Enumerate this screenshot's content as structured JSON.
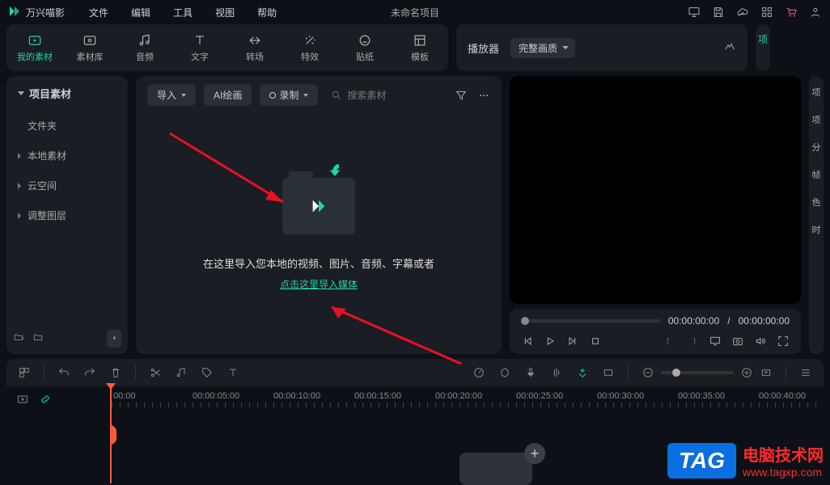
{
  "app": {
    "name": "万兴喵影",
    "project": "未命名项目"
  },
  "menu": {
    "file": "文件",
    "edit": "编辑",
    "tools": "工具",
    "view": "视图",
    "help": "帮助"
  },
  "tabs": {
    "my_media": "我的素材",
    "media_lib": "素材库",
    "audio": "音频",
    "text": "文字",
    "transition": "转场",
    "effects": "特效",
    "stickers": "贴纸",
    "templates": "模板"
  },
  "player": {
    "label": "播放器",
    "quality": "完整画质",
    "time_current": "00:00:00:00",
    "time_total": "00:00:00:00",
    "separator": "/"
  },
  "left": {
    "header": "项目素材",
    "items": {
      "folder": "文件夹",
      "local": "本地素材",
      "cloud": "云空间",
      "adjust": "调整图层"
    }
  },
  "center": {
    "import": "导入",
    "ai_draw": "AI绘画",
    "record": "录制",
    "search_placeholder": "搜索素材",
    "drop_text": "在这里导入您本地的视频、图片、音频、字幕或者",
    "drop_link": "点击这里导入媒体"
  },
  "right_labels": {
    "a": "项",
    "b": "项",
    "c": "分",
    "d": "帧",
    "e": "色",
    "f": "时"
  },
  "right_top": "项",
  "timeline": {
    "marks": [
      "00:00",
      "00:00:05:00",
      "00:00:10:00",
      "00:00:15:00",
      "00:00:20:00",
      "00:00:25:00",
      "00:00:30:00",
      "00:00:35:00",
      "00:00:40:00"
    ]
  },
  "watermark": {
    "tag": "TAG",
    "line1": "电脑技术网",
    "line2": "www.tagxp.com"
  }
}
